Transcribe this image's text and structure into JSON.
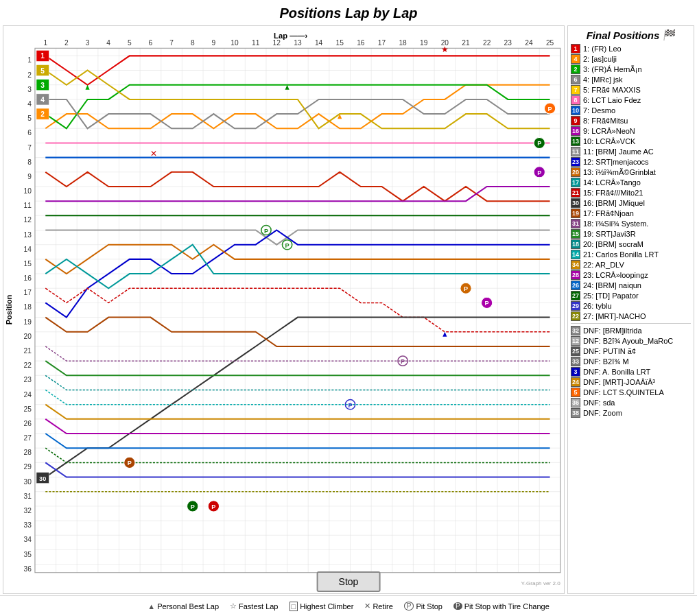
{
  "title": "Positions Lap by Lap",
  "chart": {
    "x_axis_label": "Lap",
    "y_axis_label": "Position",
    "laps": [
      1,
      2,
      3,
      4,
      5,
      6,
      7,
      8,
      9,
      10,
      11,
      12,
      13,
      14,
      15,
      16,
      17,
      18,
      19,
      20,
      21,
      22,
      23,
      24,
      25
    ],
    "positions": [
      1,
      2,
      3,
      4,
      5,
      6,
      7,
      8,
      9,
      10,
      11,
      12,
      13,
      14,
      15,
      16,
      17,
      18,
      19,
      20,
      21,
      22,
      23,
      24,
      25,
      26,
      27,
      28,
      29,
      30,
      31,
      32,
      33,
      34,
      35,
      36
    ]
  },
  "legend_title": "Final Positions",
  "legend_items": [
    {
      "pos": "1",
      "num": "1",
      "color": "#e00000",
      "text": "1: (FR) Leo"
    },
    {
      "pos": "2",
      "num": "4",
      "color": "#ff8c00",
      "text": "2: [as]culji"
    },
    {
      "pos": "3",
      "num": "2",
      "color": "#00aa00",
      "text": "3: (FR)Á HernÃ¡n"
    },
    {
      "pos": "4",
      "num": "6",
      "color": "#888888",
      "text": "4: [MRc] jsk"
    },
    {
      "pos": "5",
      "num": "7",
      "color": "#ffcc00",
      "text": "5: FRã¢ MAXXIS"
    },
    {
      "pos": "6",
      "num": "8",
      "color": "#ff69b4",
      "text": "6: LCT Laio Fdez"
    },
    {
      "pos": "7",
      "num": "10",
      "color": "#0055cc",
      "text": "7: Desmo"
    },
    {
      "pos": "8",
      "num": "9",
      "color": "#cc0000",
      "text": "8: FRã¢Mitsu"
    },
    {
      "pos": "9",
      "num": "16",
      "color": "#aa00aa",
      "text": "9: LCRÂ»NeoN"
    },
    {
      "pos": "10",
      "num": "13",
      "color": "#006600",
      "text": "10: LCRÂ»VCK"
    },
    {
      "pos": "11",
      "num": "11",
      "color": "#999999",
      "text": "11: [BRM] Jaume AC"
    },
    {
      "pos": "12",
      "num": "23",
      "color": "#0000cc",
      "text": "12: SRT|menjacocs"
    },
    {
      "pos": "13",
      "num": "20",
      "color": "#cc6600",
      "text": "13: î½î¾mÃ©Grinblat"
    },
    {
      "pos": "14",
      "num": "17",
      "color": "#009999",
      "text": "14: LCRÂ»Tango"
    },
    {
      "pos": "15",
      "num": "21",
      "color": "#cc0000",
      "text": "15: FRã¢///Mito21"
    },
    {
      "pos": "16",
      "num": "30",
      "color": "#333333",
      "text": "16: [BRM] JMiquel"
    },
    {
      "pos": "17",
      "num": "19",
      "color": "#aa4400",
      "text": "17: FRã¢Njoan"
    },
    {
      "pos": "18",
      "num": "31",
      "color": "#884488",
      "text": "18: î¾Siî¾ System."
    },
    {
      "pos": "19",
      "num": "15",
      "color": "#228B22",
      "text": "19: SRT|Javi3R"
    },
    {
      "pos": "20",
      "num": "18",
      "color": "#008B8B",
      "text": "20: [BRM] socraM"
    },
    {
      "pos": "21",
      "num": "14",
      "color": "#00aaaa",
      "text": "21: Carlos Bonilla LRT"
    },
    {
      "pos": "22",
      "num": "34",
      "color": "#cc8800",
      "text": "22: AR_DLV"
    },
    {
      "pos": "23",
      "num": "28",
      "color": "#aa00aa",
      "text": "23: LCRÂ»loopingz"
    },
    {
      "pos": "24",
      "num": "26",
      "color": "#0066cc",
      "text": "24: [BRM] naiqun"
    },
    {
      "pos": "25",
      "num": "27",
      "color": "#006600",
      "text": "25: [TD] Papator"
    },
    {
      "pos": "26",
      "num": "29",
      "color": "#3333cc",
      "text": "26: tyblu"
    },
    {
      "pos": "27",
      "num": "22",
      "color": "#888800",
      "text": "27: [MRT]-NACHO"
    },
    {
      "pos": "dnf1",
      "num": "32",
      "color": "#888888",
      "text": "DNF: [BRM]iltrida"
    },
    {
      "pos": "dnf2",
      "num": "12",
      "color": "#aaaaaa",
      "text": "DNF: B2î¾ Ayoub_MaRoC"
    },
    {
      "pos": "dnf3",
      "num": "25",
      "color": "#555555",
      "text": "DNF: PUTIN ã¢"
    },
    {
      "pos": "dnf4",
      "num": "33",
      "color": "#777777",
      "text": "DNF: B2î¾ M"
    },
    {
      "pos": "dnf5",
      "num": "3",
      "color": "#0000bb",
      "text": "DNF: A. Bonilla LRT"
    },
    {
      "pos": "dnf6",
      "num": "24",
      "color": "#cc8800",
      "text": "DNF: [MRT]-JOAÂïÂ³"
    },
    {
      "pos": "dnf7",
      "num": "5",
      "color": "#ff6600",
      "text": "DNF: LCT S.QUINTELA"
    },
    {
      "pos": "dnf8",
      "num": "36",
      "color": "#aaaaaa",
      "text": "DNF: sda"
    },
    {
      "pos": "dnf9",
      "num": "38",
      "color": "#888888",
      "text": "DNF: Zoom"
    }
  ],
  "footer_legend": [
    {
      "symbol": "▲",
      "label": "Personal Best Lap"
    },
    {
      "symbol": "☆",
      "label": "Fastest Lap"
    },
    {
      "symbol": "□",
      "label": "Highest Climber"
    },
    {
      "symbol": "✕",
      "label": "Retire"
    },
    {
      "symbol": "P",
      "label": "Pit Stop"
    },
    {
      "symbol": "Ⓟ",
      "label": "Pit Stop with Tire Change"
    }
  ],
  "stop_button": "Stop",
  "version": "Y-Graph ver 2.0"
}
